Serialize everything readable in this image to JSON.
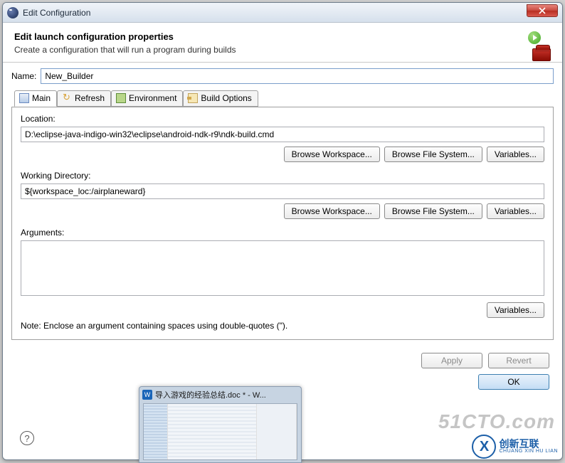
{
  "window": {
    "title": "Edit Configuration"
  },
  "header": {
    "title": "Edit launch configuration properties",
    "desc": "Create a configuration that will run a program during builds"
  },
  "name": {
    "label": "Name:",
    "value": "New_Builder"
  },
  "tabs": {
    "main": "Main",
    "refresh": "Refresh",
    "environment": "Environment",
    "build_options": "Build Options"
  },
  "main_panel": {
    "location_label": "Location:",
    "location_value": "D:\\eclipse-java-indigo-win32\\eclipse\\android-ndk-r9\\ndk-build.cmd",
    "workdir_label": "Working Directory:",
    "workdir_value": "${workspace_loc:/airplaneward}",
    "arguments_label": "Arguments:",
    "arguments_value": "",
    "browse_workspace": "Browse Workspace...",
    "browse_filesystem": "Browse File System...",
    "variables": "Variables...",
    "note": "Note: Enclose an argument containing spaces using double-quotes (\")."
  },
  "buttons": {
    "apply": "Apply",
    "revert": "Revert",
    "ok": "OK"
  },
  "taskbar": {
    "title": "导入游戏的经验总结.doc * - W..."
  },
  "watermark": {
    "text": "51CTO.com",
    "brand": "创新互联",
    "sub": "CHUANG XIN HU LIAN"
  }
}
